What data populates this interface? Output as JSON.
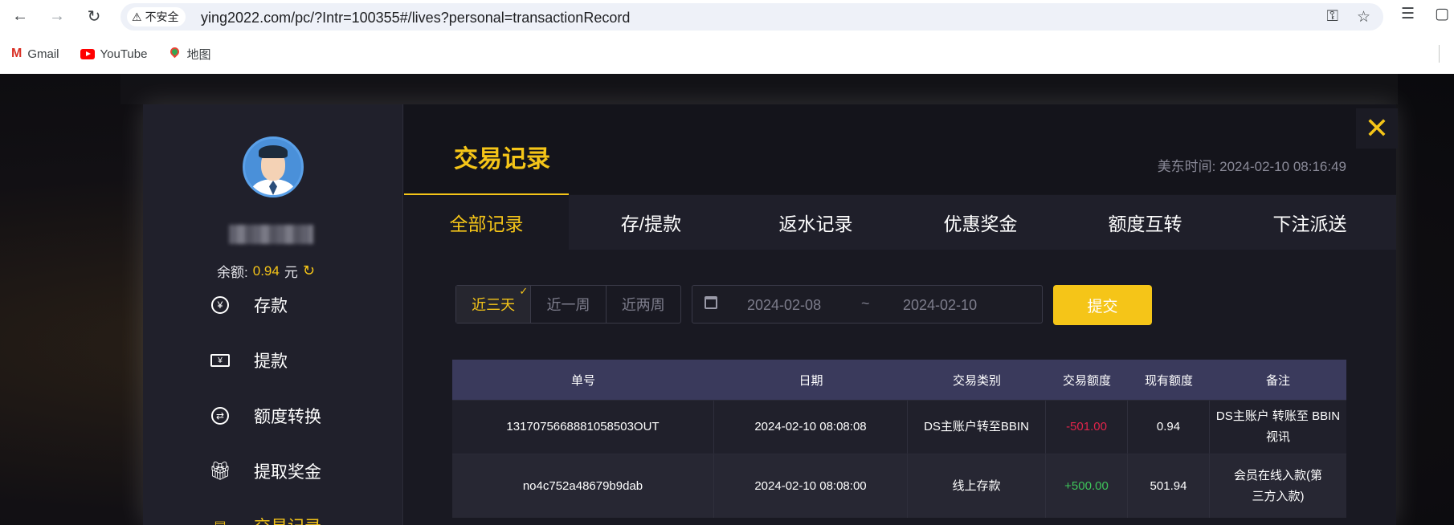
{
  "browser": {
    "security_label": "不安全",
    "url": "ying2022.com/pc/?Intr=100355#/lives?personal=transactionRecord",
    "bookmarks": [
      {
        "label": "Gmail",
        "icon": "gmail-icon"
      },
      {
        "label": "YouTube",
        "icon": "youtube-icon"
      },
      {
        "label": "地图",
        "icon": "maps-icon"
      }
    ]
  },
  "sidebar": {
    "balance_label": "余额:",
    "balance_value": "0.94",
    "balance_unit": "元",
    "menu": [
      {
        "label": "存款",
        "icon": "deposit-icon"
      },
      {
        "label": "提款",
        "icon": "withdraw-icon"
      },
      {
        "label": "额度转换",
        "icon": "transfer-icon"
      },
      {
        "label": "提取奖金",
        "icon": "gift-icon"
      },
      {
        "label": "交易记录",
        "icon": "record-icon",
        "active": true
      }
    ]
  },
  "header": {
    "title": "交易记录",
    "clock": "美东时间: 2024-02-10 08:16:49",
    "close_symbol": "✕"
  },
  "tabs": [
    {
      "label": "全部记录",
      "active": true
    },
    {
      "label": "存/提款"
    },
    {
      "label": "返水记录"
    },
    {
      "label": "优惠奖金"
    },
    {
      "label": "额度互转"
    },
    {
      "label": "下注派送"
    }
  ],
  "filters": {
    "ranges": [
      {
        "label": "近三天",
        "active": true
      },
      {
        "label": "近一周"
      },
      {
        "label": "近两周"
      }
    ],
    "date_start": "2024-02-08",
    "date_sep": "~",
    "date_end": "2024-02-10",
    "submit_label": "提交"
  },
  "table": {
    "columns": [
      "单号",
      "日期",
      "交易类别",
      "交易额度",
      "现有额度",
      "备注"
    ],
    "rows": [
      {
        "id": "1317075668881058503OUT",
        "date": "2024-02-10 08:08:08",
        "type": "DS主账户转至BBIN",
        "amount": "-501.00",
        "balance": "0.94",
        "note": "DS主账户 转账至 BBIN视讯"
      },
      {
        "id": "no4c752a48679b9dab",
        "date": "2024-02-10 08:08:00",
        "type": "线上存款",
        "amount": "+500.00",
        "balance": "501.94",
        "note": "会员在线入款(第三方入款)"
      }
    ]
  },
  "colors": {
    "accent": "#f5c518",
    "negative": "#e0244a",
    "positive": "#3ec45a",
    "table_header": "#3a3a5c"
  }
}
